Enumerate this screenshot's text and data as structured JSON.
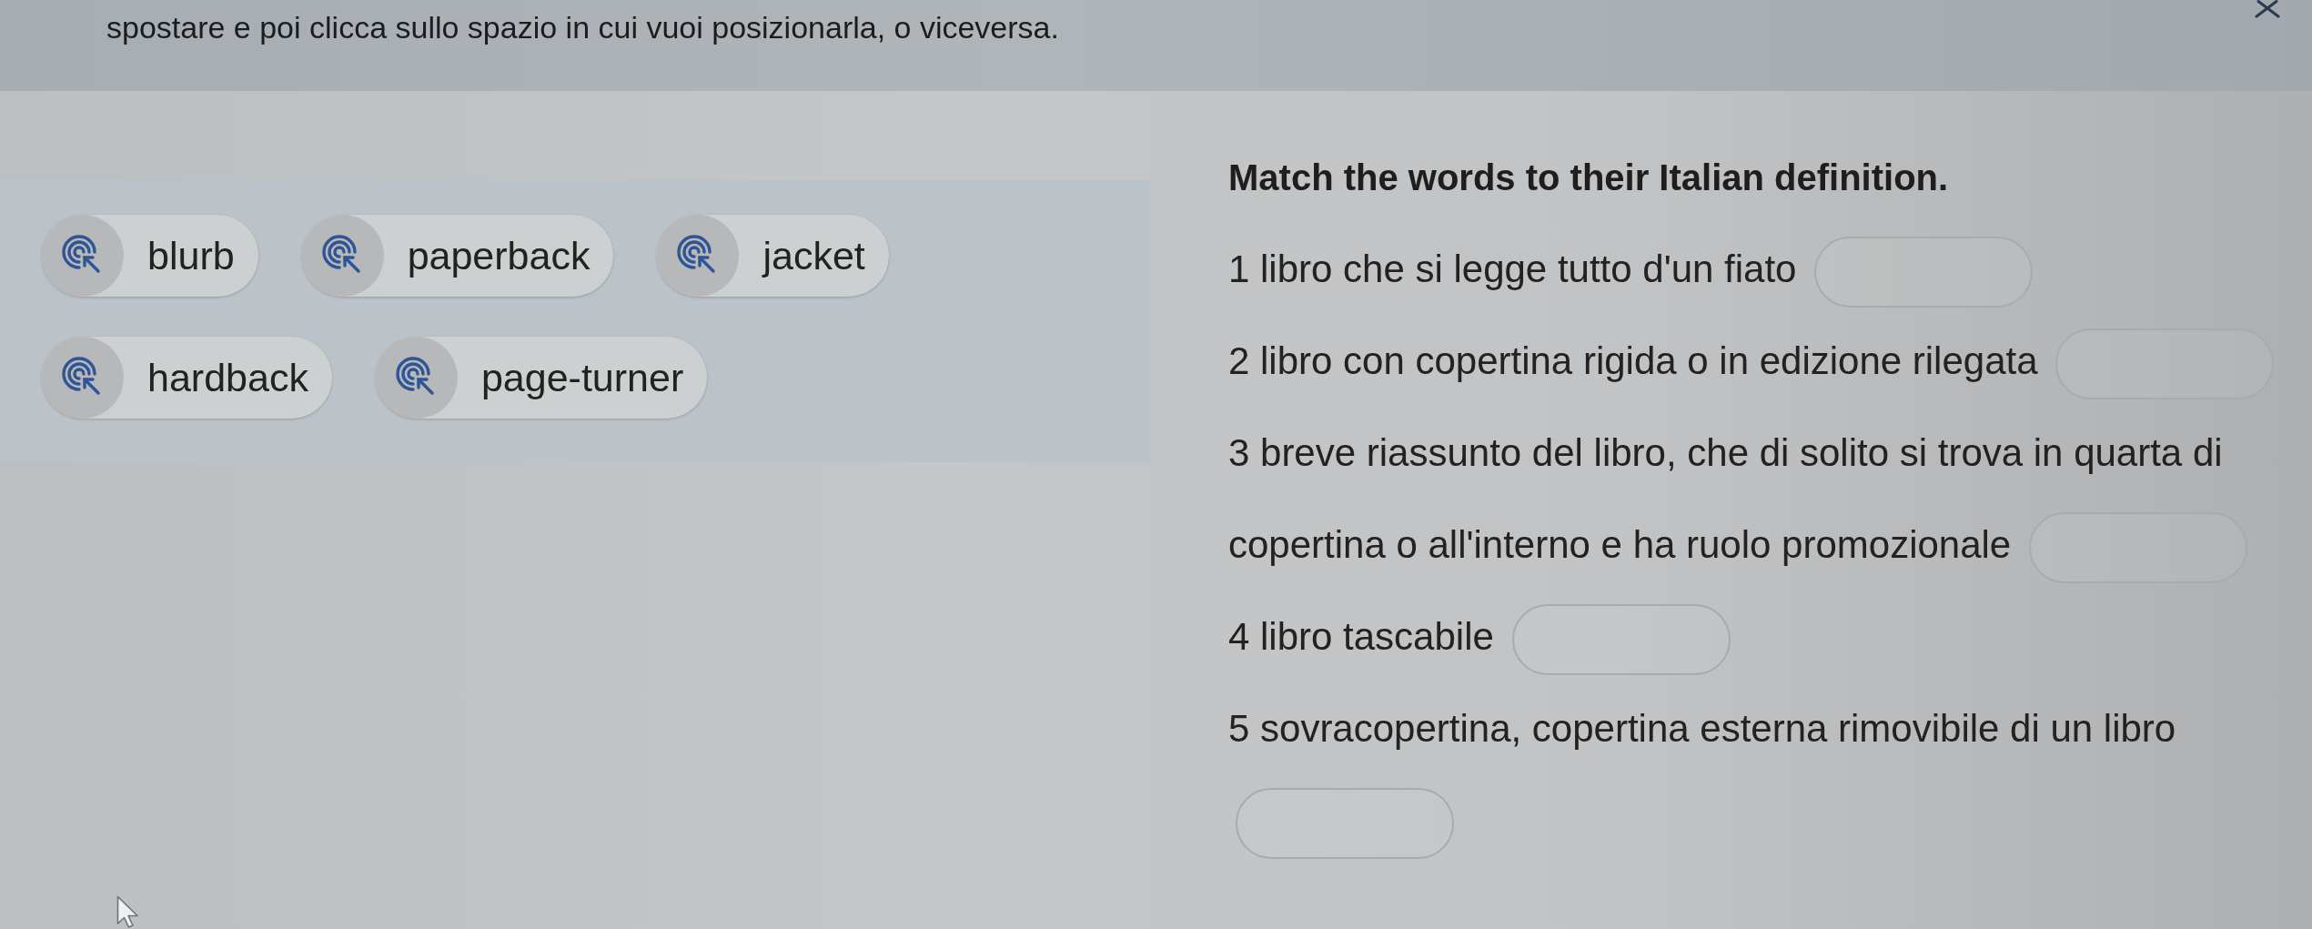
{
  "instruction": "spostare e poi clicca sullo spazio in cui vuoi posizionarla, o viceversa.",
  "word_bank": {
    "rows": [
      [
        {
          "label": "blurb"
        },
        {
          "label": "paperback"
        },
        {
          "label": "jacket"
        }
      ],
      [
        {
          "label": "hardback"
        },
        {
          "label": "page-turner"
        }
      ]
    ]
  },
  "exercise": {
    "title": "Match the words to their Italian definition.",
    "items": [
      {
        "lines": [
          "1 libro che si legge tutto d'un fiato"
        ]
      },
      {
        "lines": [
          "2 libro con copertina rigida o in edizione rilegata"
        ]
      },
      {
        "lines": [
          "3 breve riassunto del libro, che di solito si trova in quarta di",
          "copertina o all'interno e ha ruolo promozionale"
        ]
      },
      {
        "lines": [
          "4 libro tascabile"
        ]
      },
      {
        "lines": [
          "5 sovracopertina, copertina esterna rimovibile di un libro"
        ]
      }
    ]
  }
}
